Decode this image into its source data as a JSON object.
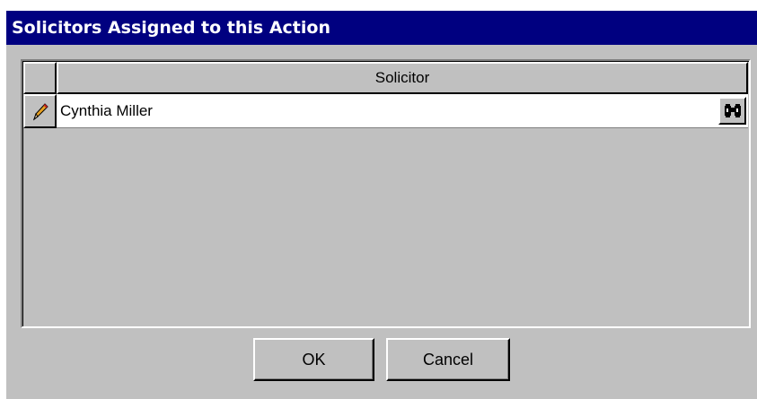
{
  "window": {
    "title": "Solicitors Assigned to this Action"
  },
  "grid": {
    "columns": [
      "Solicitor"
    ],
    "rows": [
      {
        "solicitor": "Cynthia Miller",
        "row_icon": "pencil-icon",
        "lookup_icon": "binoculars-icon"
      }
    ]
  },
  "buttons": {
    "ok": "OK",
    "cancel": "Cancel"
  },
  "colors": {
    "titlebar": "#000080",
    "face": "#c0c0c0",
    "cell": "#ffffff"
  }
}
